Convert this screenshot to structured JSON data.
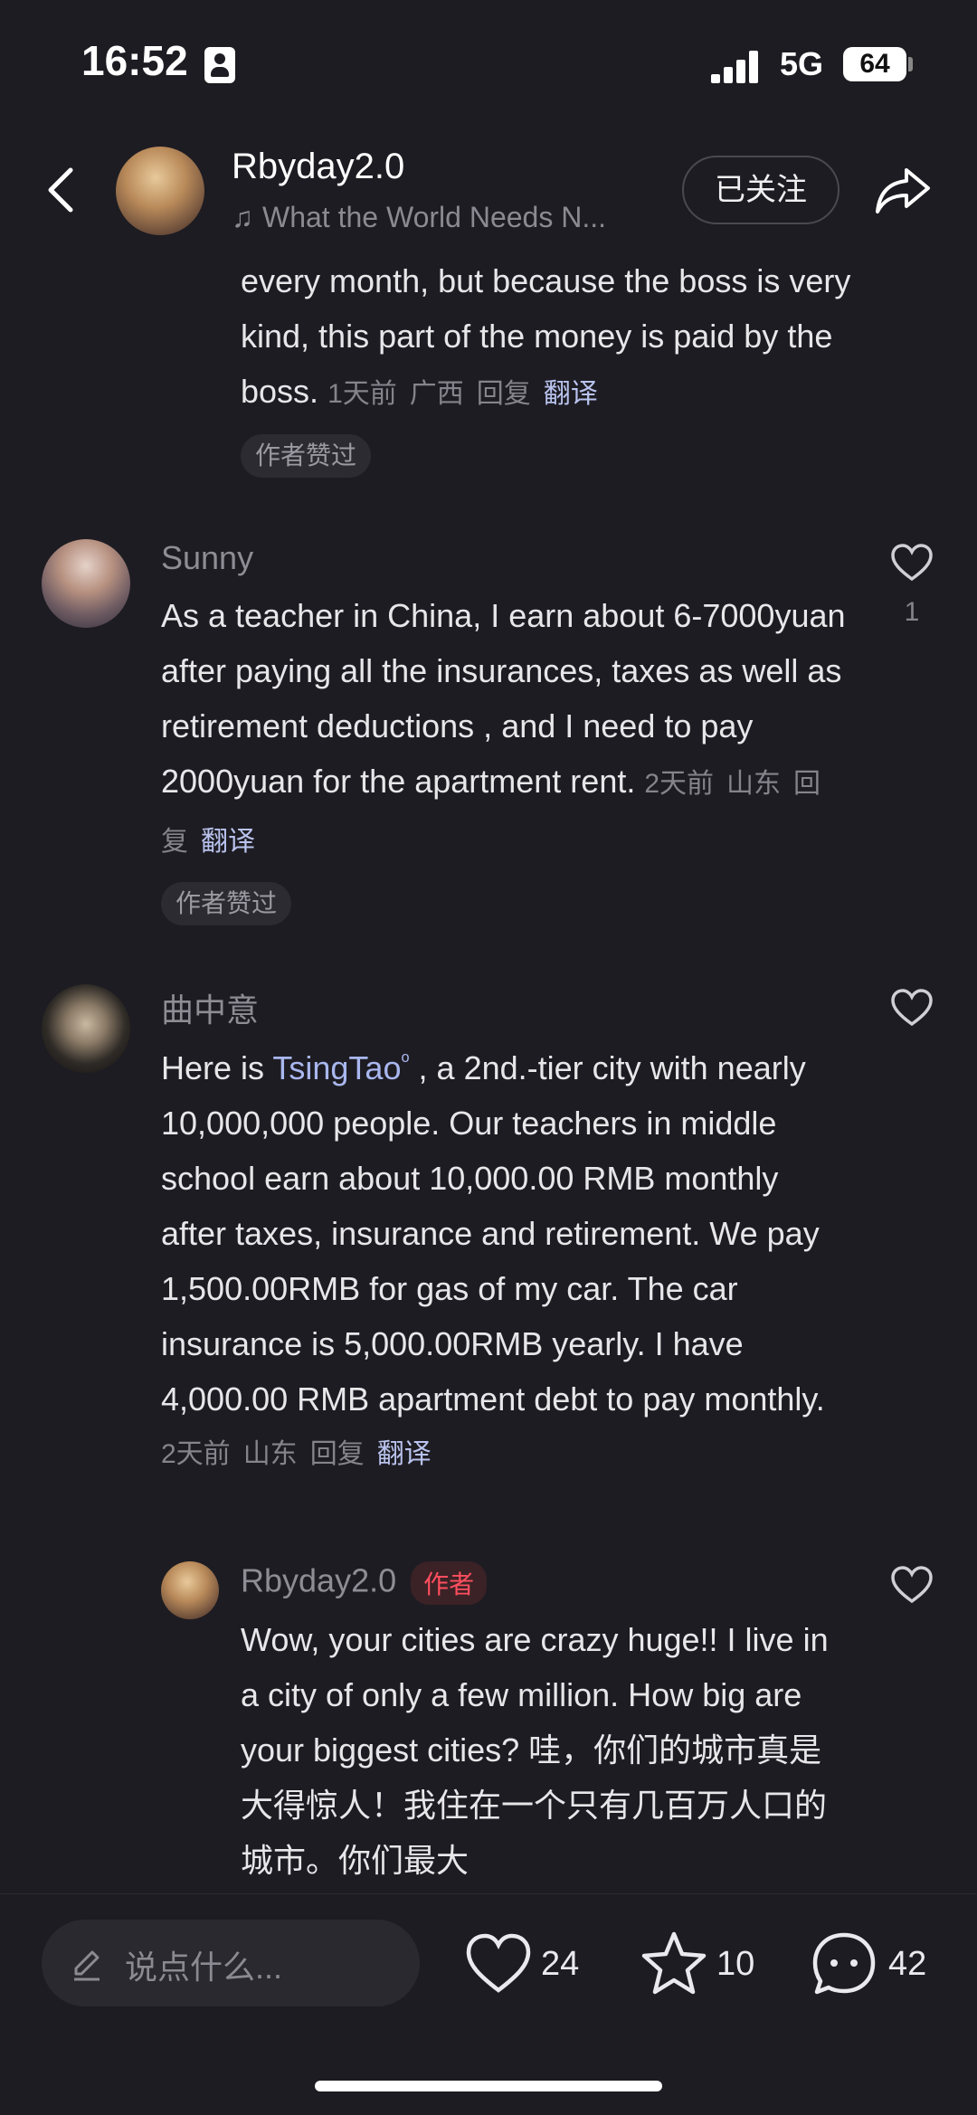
{
  "status_bar": {
    "time": "16:52",
    "network": "5G",
    "battery": "64"
  },
  "header": {
    "author": "Rbyday2.0",
    "music": "What the World Needs N...",
    "follow_label": "已关注"
  },
  "comments": [
    {
      "text": "every month, but because the boss is very kind, this part of the money is paid by the boss.",
      "time": "1天前",
      "location": "广西",
      "reply": "回复",
      "translate": "翻译",
      "liked_chip": "作者赞过"
    },
    {
      "user": "Sunny",
      "text": "As a teacher in China, I earn about 6-7000yuan after paying all the insurances, taxes as well as retirement deductions , and I need to pay 2000yuan for the apartment rent.",
      "time": "2天前",
      "location": "山东",
      "reply": "回复",
      "translate": "翻译",
      "liked_chip": "作者赞过",
      "likes": "1"
    },
    {
      "user": "曲中意",
      "text_before": "Here is ",
      "link": "TsingTao",
      "text_after": " , a  2nd.-tier city with nearly 10,000,000 people. Our teachers in middle school earn about 10,000.00 RMB monthly after taxes, insurance and retirement. We pay 1,500.00RMB for gas of my car. The car insurance is 5,000.00RMB yearly. I have 4,000.00 RMB apartment debt to pay monthly.",
      "time": "2天前",
      "location": "山东",
      "reply": "回复",
      "translate": "翻译"
    },
    {
      "user": "Rbyday2.0",
      "author_tag": "作者",
      "text": "Wow, your cities are crazy huge!! I live in a city of only a few million. How big are your biggest cities? 哇，你们的城市真是大得惊人！我住在一个只有几百万人口的城市。你们最大"
    }
  ],
  "bottom_bar": {
    "input_placeholder": "说点什么...",
    "likes": "24",
    "favorites": "10",
    "comments": "42"
  }
}
